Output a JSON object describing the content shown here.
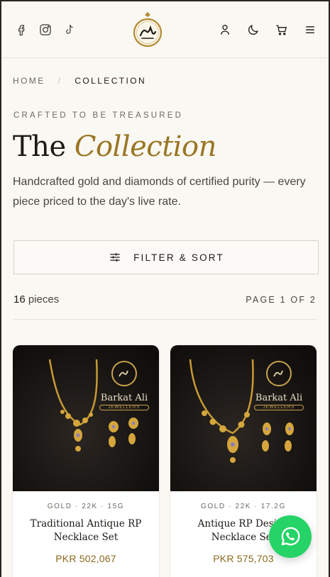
{
  "header": {
    "social": [
      "facebook-icon",
      "instagram-icon",
      "tiktok-icon"
    ],
    "actions": [
      "account-icon",
      "theme-toggle-icon",
      "cart-icon",
      "menu-icon"
    ]
  },
  "breadcrumb": {
    "home": "HOME",
    "separator": "/",
    "current": "COLLECTION"
  },
  "hero": {
    "eyebrow": "CRAFTED TO BE TREASURED",
    "title_plain": "The",
    "title_accent": "Collection",
    "description": "Handcrafted gold and diamonds of certified purity — every piece priced to the day's live rate."
  },
  "filter": {
    "label": "FILTER & SORT"
  },
  "results": {
    "count": "16",
    "count_label": "pieces",
    "page": "PAGE 1 OF 2"
  },
  "products": [
    {
      "spec": "GOLD · 22K · 15G",
      "name": "Traditional Antique RP Necklace Set",
      "price": "PKR 502,067",
      "brand": "Barkat Ali",
      "brand_sub": "JEWELLERS"
    },
    {
      "spec": "GOLD · 22K · 17.2G",
      "name": "Antique RP Design Necklace Set",
      "price": "PKR 575,703",
      "brand": "Barkat Ali",
      "brand_sub": "JEWELLERS"
    }
  ],
  "colors": {
    "accent": "#9a7624",
    "price": "#8a6a1f",
    "whatsapp": "#25d366",
    "background": "#faf8f3"
  }
}
